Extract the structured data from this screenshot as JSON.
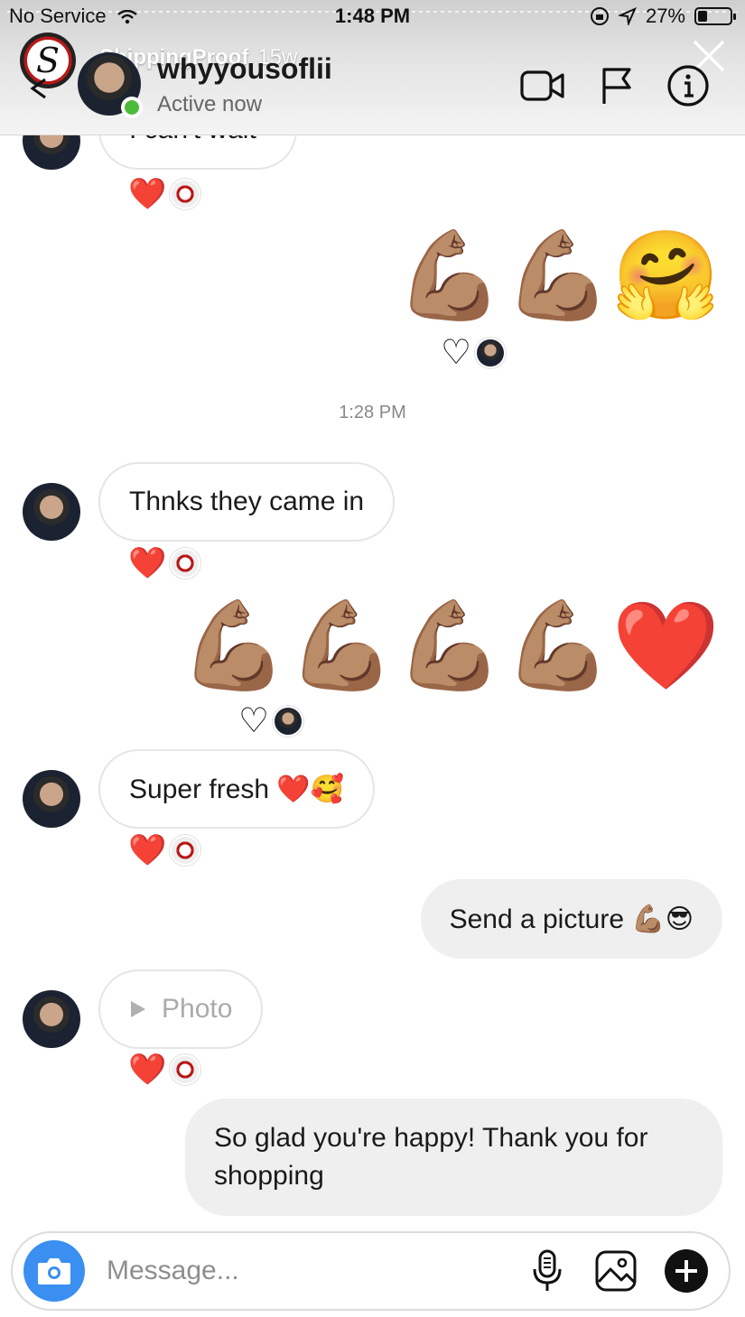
{
  "status_bar": {
    "carrier": "No Service",
    "time": "1:48 PM",
    "battery": "27%"
  },
  "story": {
    "account": "ShippingProof",
    "age": "15w",
    "logo_letter": "S"
  },
  "header": {
    "username": "whyyousoflii",
    "status": "Active now"
  },
  "messages": {
    "partial_text": "I can't wait",
    "emoji_1": "💪🏽💪🏽🤗",
    "timestamp": "1:28 PM",
    "in_1": "Thnks they came in",
    "emoji_2": "💪🏽💪🏽💪🏽💪🏽❤️",
    "in_2": "Super fresh ❤️🥰",
    "out_1": "Send a picture 💪🏽😎",
    "in_3_photo": "Photo",
    "out_2": "So glad you're happy! Thank you for shopping"
  },
  "reactions": {
    "heart_filled": "❤️",
    "heart_outline": "♡"
  },
  "composer": {
    "placeholder": "Message..."
  },
  "colors": {
    "accent_camera": "#3a8ff0",
    "online": "#4cbb3a",
    "bubble_out": "#efefef",
    "heart": "#e0364b"
  }
}
